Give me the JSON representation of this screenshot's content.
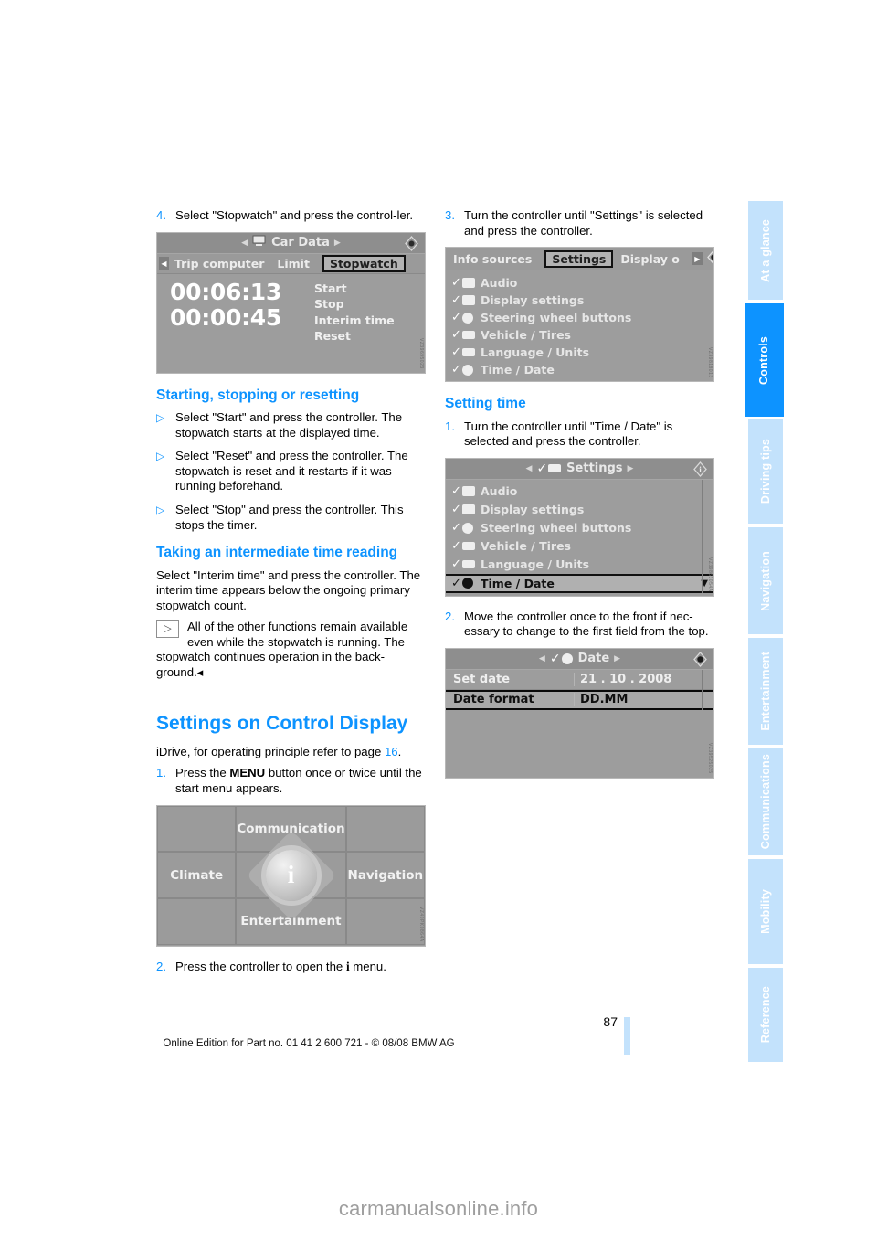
{
  "document": {
    "page_number": "87",
    "footer": "Online Edition for Part no. 01 41 2 600 721 - © 08/08 BMW AG",
    "watermark": "carmanualsonline.info",
    "accent_color": "#0d93ff",
    "tab_inactive_color": "#c3e2fc"
  },
  "side_tabs": [
    {
      "label": "At a glance",
      "active": false
    },
    {
      "label": "Controls",
      "active": true
    },
    {
      "label": "Driving tips",
      "active": false
    },
    {
      "label": "Navigation",
      "active": false
    },
    {
      "label": "Entertainment",
      "active": false
    },
    {
      "label": "Communications",
      "active": false
    },
    {
      "label": "Mobility",
      "active": false
    },
    {
      "label": "Reference",
      "active": false
    }
  ],
  "left_column": {
    "step4": {
      "num": "4.",
      "text": "Select \"Stopwatch\" and press the control-ler."
    },
    "stopwatch_screen": {
      "title": "Car Data",
      "tabs": [
        "Trip computer",
        "Limit",
        "Stopwatch"
      ],
      "selected_tab": "Stopwatch",
      "primary_time": "00:06:13",
      "interim_time": "00:00:45",
      "options": [
        "Start",
        "Stop",
        "Interim time",
        "Reset"
      ],
      "figure_code": "VZ39695023"
    },
    "heading_start_stop": "Starting, stopping or resetting",
    "bullets": [
      "Select \"Start\" and press the controller. The stopwatch starts at the displayed time.",
      "Select \"Reset\" and press the controller. The stopwatch is reset and it restarts if it was running beforehand.",
      "Select \"Stop\" and press the controller. This stops the timer."
    ],
    "heading_interim": "Taking an intermediate time reading",
    "interim_paragraph": "Select \"Interim time\" and press the controller. The interim time appears below the ongoing primary stopwatch count.",
    "note": "All of the other functions remain available even while the stopwatch is running. The stopwatch continues operation in the back-ground.",
    "heading_settings": "Settings on Control Display",
    "idrive_intro_a": "iDrive, for operating principle refer to page ",
    "idrive_intro_page": "16",
    "idrive_intro_b": ".",
    "step1": {
      "num": "1.",
      "text_a": "Press the ",
      "button": "MENU",
      "text_b": " button once or twice until the start menu appears."
    },
    "start_menu_screen": {
      "top": "Communication",
      "left": "Climate",
      "right": "Navigation",
      "bottom": "Entertainment",
      "center_icon": "i",
      "figure_code": "VZ40PK0864A"
    },
    "step2": {
      "num": "2.",
      "text_a": "Press the controller to open the ",
      "icon": "i",
      "text_b": " menu."
    }
  },
  "right_column": {
    "step3": {
      "num": "3.",
      "text": "Turn the controller until \"Settings\" is selected and press the controller."
    },
    "info_screen": {
      "tabs": [
        "Info sources",
        "Settings",
        "Display o"
      ],
      "selected_tab": "Settings",
      "items": [
        "Audio",
        "Display settings",
        "Steering wheel buttons",
        "Vehicle / Tires",
        "Language / Units",
        "Time / Date"
      ],
      "figure_code": "VZ39818013"
    },
    "heading_setting_time": "Setting time",
    "step1": {
      "num": "1.",
      "text": "Turn the controller until \"Time / Date\" is selected and press the controller."
    },
    "settings_screen": {
      "title": "Settings",
      "items": [
        "Audio",
        "Display settings",
        "Steering wheel buttons",
        "Vehicle / Tires",
        "Language / Units",
        "Time / Date"
      ],
      "selected_item": "Time / Date",
      "figure_code": "VZ39863054A"
    },
    "step2": {
      "num": "2.",
      "text": "Move the controller once to the front if nec-essary to change to the first field from the top."
    },
    "date_screen": {
      "title": "Date",
      "rows": [
        {
          "key": "Set date",
          "value": "21 . 10 . 2008",
          "selected": false
        },
        {
          "key": "Date format",
          "value": "DD.MM",
          "selected": true
        }
      ],
      "figure_code": "VZ39525025"
    }
  }
}
